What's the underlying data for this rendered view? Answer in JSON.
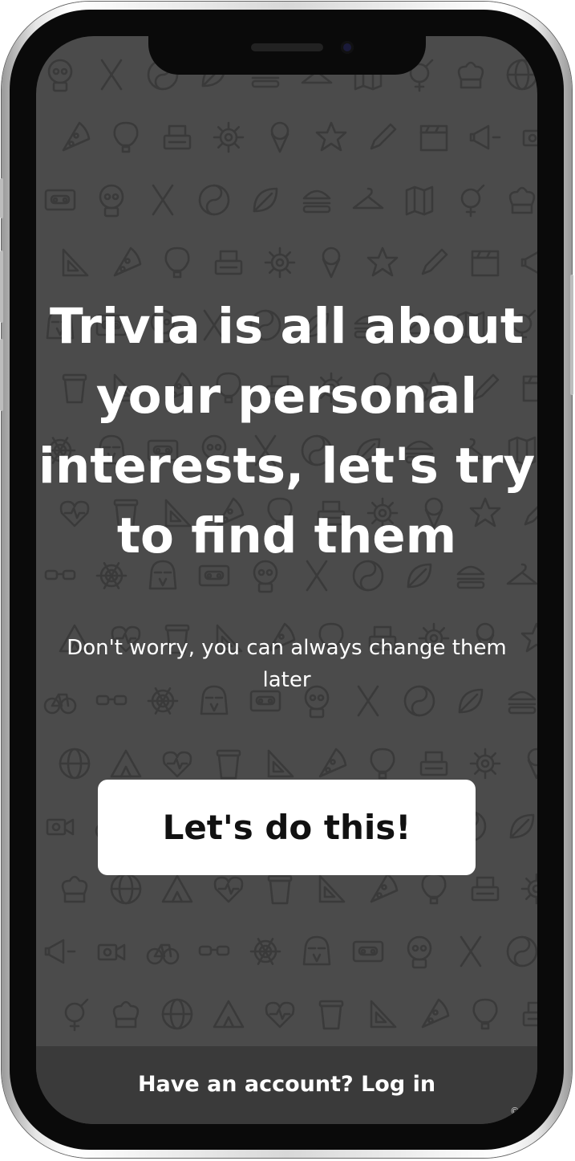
{
  "onboarding": {
    "headline": "Trivia is all about your personal interests, let's try to find them",
    "subtext": "Don't worry, you can always change them later",
    "cta_label": "Let's do this!",
    "login_text": "Have an account? Log in",
    "copyright_mark": "©"
  },
  "colors": {
    "background": "#4b4b4b",
    "pattern_stroke": "#3a3a3a",
    "bottom_bar": "#3a3a3a",
    "button": "#ffffff",
    "text": "#ffffff"
  },
  "background_icons": [
    "skull-icon",
    "fork-knife-icon",
    "yin-yang-icon",
    "leaf-icon",
    "burger-icon",
    "hanger-icon",
    "map-icon",
    "gender-icon",
    "chef-hat-icon",
    "globe-icon",
    "tent-icon",
    "heart-rate-icon",
    "coffee-cup-icon",
    "ruler-icon",
    "pizza-icon",
    "balloon-icon",
    "typewriter-icon",
    "helm-icon",
    "ice-cream-icon",
    "star-icon",
    "pencil-icon",
    "film-clapper-icon",
    "megaphone-icon",
    "camera-icon",
    "bicycle-icon",
    "glasses-icon",
    "spider-web-icon",
    "darth-vader-icon",
    "cassette-icon"
  ]
}
